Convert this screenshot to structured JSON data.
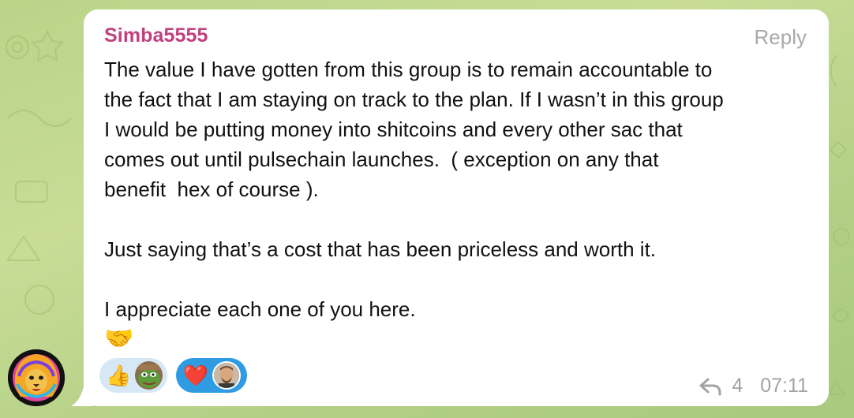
{
  "message": {
    "sender": "Simba5555",
    "reply_label": "Reply",
    "text": "The value I have gotten from this group is to remain accountable to\nthe fact that I am staying on track to the plan. If I wasn’t in this group\nI would be putting money into shitcoins and every other sac that\ncomes out until pulsechain launches.  ( exception on any that\nbenefit  hex of course ).\n\nJust saying that’s a cost that has been priceless and worth it.\n\nI appreciate each one of you here.",
    "emoji": "🤝",
    "reply_count": "4",
    "time": "07:11",
    "reactions": [
      {
        "emoji": "👍",
        "icon": "pepe-avatar",
        "selected": false
      },
      {
        "emoji": "❤️",
        "icon": "man-avatar",
        "selected": true
      }
    ]
  },
  "colors": {
    "sender": "#c1417f",
    "meta": "#a3a3a3",
    "selected_reaction": "#2f9be3",
    "reaction": "#d6e8f6"
  },
  "icons": {
    "sender_avatar": "lion-avatar",
    "reply_count_icon": "reply-arrow-icon"
  }
}
